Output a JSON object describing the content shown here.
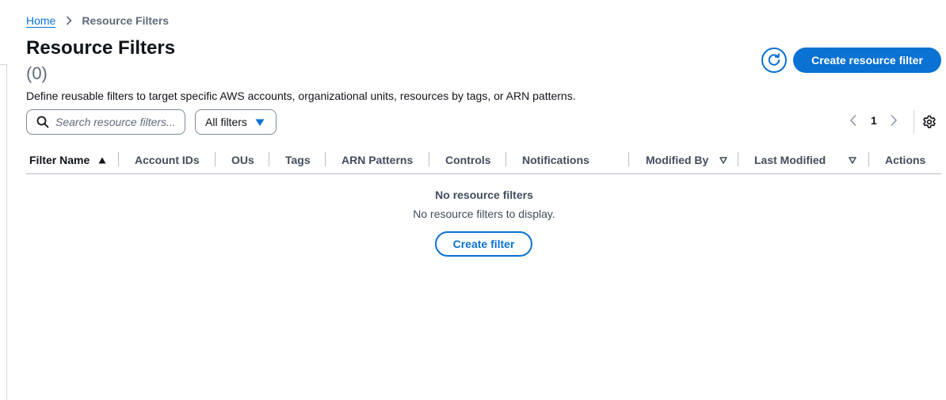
{
  "breadcrumb": {
    "home": "Home",
    "current": "Resource Filters"
  },
  "header": {
    "title": "Resource Filters",
    "count": "(0)",
    "description": "Define reusable filters to target specific AWS accounts, organizational units, resources by tags, or ARN patterns.",
    "create_label": "Create resource filter"
  },
  "toolbar": {
    "search_placeholder": "Search resource filters...",
    "filter_selected": "All filters",
    "current_page": "1"
  },
  "table": {
    "columns": [
      "Filter Name",
      "Account IDs",
      "OUs",
      "Tags",
      "ARN Patterns",
      "Controls",
      "Notifications",
      "Modified By",
      "Last Modified",
      "Actions"
    ],
    "sort_column": "Filter Name",
    "sort_direction": "ascending"
  },
  "empty_state": {
    "title": "No resource filters",
    "description": "No resource filters to display.",
    "button_label": "Create filter"
  },
  "colors": {
    "accent": "#0972d3",
    "text": "#0f141a",
    "muted": "#5f6b7a",
    "border": "#b6bec9"
  },
  "icons": [
    "chevron-right-icon",
    "refresh-icon",
    "search-icon",
    "caret-down-icon",
    "chevron-left-icon",
    "settings-icon",
    "sort-ascending-icon",
    "sort-descending-icon"
  ]
}
